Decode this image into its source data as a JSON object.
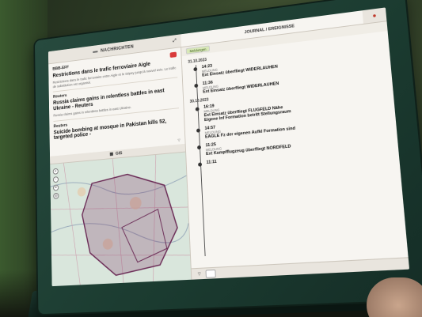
{
  "left_pane": {
    "title": "Nachrichten"
  },
  "news": {
    "items": [
      {
        "source": "BBB-EFF",
        "badge": "",
        "headline": "Restrictions dans le trafic ferroviaire Aigle",
        "text": "Restrictions dans le trafic ferroviaire entre Aigle et le Sépey jusqu'à nouvel avis. Le trafic de substitution est organisé.",
        "meta": "",
        "tag": ""
      },
      {
        "source": "Reuters",
        "headline": "Russia claims gains in relentless battles in east Ukraine - Reuters",
        "text": "Russia claims gains in relentless battles in east Ukraine.",
        "tag": ""
      },
      {
        "source": "Reuters",
        "headline": "Suicide bombing at mosque in Pakistan kills 52, targeted police -",
        "text": ""
      }
    ],
    "footer": ""
  },
  "gis": {
    "title": "GIS"
  },
  "right_pane": {
    "tabs": [
      "Journal / Ereignisse"
    ],
    "subtabs": [
      "Meldungen"
    ]
  },
  "journal": {
    "days": [
      {
        "date": "31.10.2023",
        "entries": [
          {
            "time": "14:23",
            "kind": "Meldung",
            "title": "Ext Einsatz überfliegt WIDERLAUHEN",
            "desc": ""
          },
          {
            "time": "11:36",
            "kind": "Meldung",
            "title": "Ext Einsatz überfliegt WIDERLAUHEN",
            "desc": ""
          }
        ]
      },
      {
        "date": "30.10.2023",
        "entries": [
          {
            "time": "16:19",
            "kind": "Meldung",
            "title": "Ext Einsatz überfliegt FLUGFELD Nähe",
            "desc": ""
          },
          {
            "time": "",
            "kind": "",
            "title": "Eigene Inf Formation betritt Stellungsraum",
            "desc": ""
          },
          {
            "time": "14:57",
            "kind": "Meldung",
            "title": "EAGLE Fz der eigenen Aufkl Formation sind",
            "desc": ""
          },
          {
            "time": "11:25",
            "kind": "Meldung",
            "title": "Ext Kampfflugzeug überfliegt NORDFELD",
            "desc": ""
          },
          {
            "time": "11:11",
            "kind": "",
            "title": "",
            "desc": ""
          }
        ]
      }
    ],
    "footer_button": ""
  },
  "colors": {
    "accent_red": "#d93a3a",
    "bezel": "#1b3b30",
    "screen_bg": "#f2efe9"
  }
}
